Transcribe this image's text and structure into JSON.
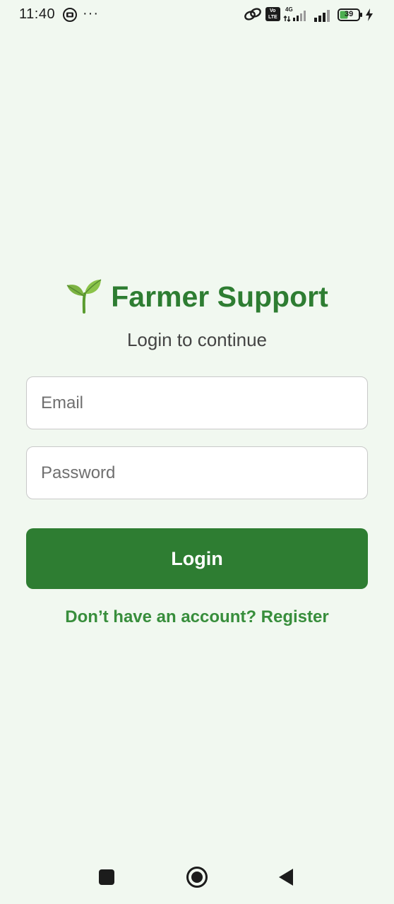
{
  "status_bar": {
    "time": "11:40",
    "dots": "···",
    "volte_label_top": "Vo",
    "volte_label_bottom": "LTE",
    "network_label": "4G",
    "battery_level": "39",
    "icons": [
      "sim-notification-icon",
      "link-icon",
      "volte-icon",
      "signal-4g-icon",
      "signal-icon",
      "battery-icon",
      "charging-icon"
    ]
  },
  "brand": {
    "logo_emoji": "🌱",
    "title": "Farmer Support"
  },
  "subtitle": "Login to continue",
  "form": {
    "email_placeholder": "Email",
    "email_value": "",
    "password_placeholder": "Password",
    "password_value": "",
    "login_label": "Login",
    "register_text": "Don’t have an account? Register"
  },
  "colors": {
    "background": "#f1f8f0",
    "primary": "#2e7d32",
    "link": "#388e3c"
  },
  "nav_bar": {
    "icons": [
      "recents-icon",
      "home-icon",
      "back-icon"
    ]
  }
}
